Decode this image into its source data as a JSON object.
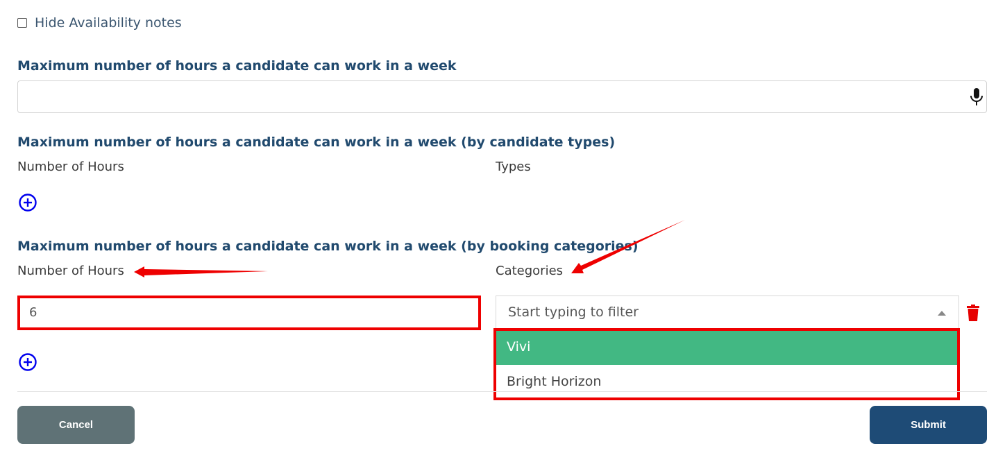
{
  "availability": {
    "hide_notes_label": "Hide Availability notes",
    "hide_notes_checked": false
  },
  "max_hours_week": {
    "title": "Maximum number of hours a candidate can work in a week",
    "value": ""
  },
  "by_candidate_types": {
    "title": "Maximum number of hours a candidate can work in a week (by candidate types)",
    "col_hours": "Number of Hours",
    "col_types": "Types"
  },
  "by_booking_categories": {
    "title": "Maximum number of hours a candidate can work in a week (by booking categories)",
    "col_hours": "Number of Hours",
    "col_categories": "Categories",
    "row": {
      "hours": "6",
      "categories_placeholder": "Start typing to filter",
      "options": [
        "Vivi",
        "Bright Horizon"
      ],
      "highlighted_option": "Vivi"
    }
  },
  "actions": {
    "cancel_label": "Cancel",
    "submit_label": "Submit"
  },
  "colors": {
    "title": "#214a6e",
    "annotation_red": "#ee0000",
    "option_highlight": "#42b883",
    "cancel_bg": "#5f7276",
    "submit_bg": "#1e4b76",
    "add_icon": "#0000ee",
    "trash_icon": "#e60000"
  },
  "icons": [
    "microphone-icon",
    "add-circle-icon",
    "trash-icon",
    "caret-up-icon"
  ]
}
